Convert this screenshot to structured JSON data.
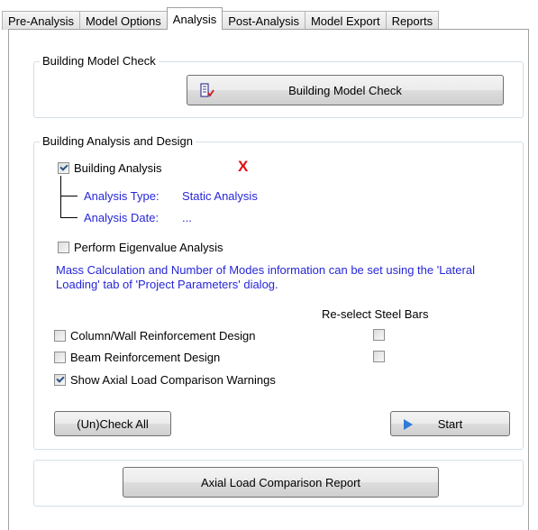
{
  "tabs": [
    {
      "label": "Pre-Analysis"
    },
    {
      "label": "Model Options"
    },
    {
      "label": "Analysis"
    },
    {
      "label": "Post-Analysis"
    },
    {
      "label": "Model Export"
    },
    {
      "label": "Reports"
    }
  ],
  "model_check": {
    "group_label": "Building Model Check",
    "button_label": "Building Model Check"
  },
  "analysis_design": {
    "group_label": "Building Analysis and Design",
    "building_analysis": {
      "label": "Building Analysis",
      "checked": true,
      "status_mark": "X"
    },
    "analysis_type": {
      "label": "Analysis Type:",
      "value": "Static Analysis"
    },
    "analysis_date": {
      "label": "Analysis Date:",
      "value": "..."
    },
    "eigenvalue": {
      "label": "Perform Eigenvalue Analysis",
      "checked": false
    },
    "info_text": "Mass Calculation and Number of Modes information can be set using the 'Lateral Loading' tab of 'Project Parameters' dialog.",
    "reselect_header": "Re-select Steel Bars",
    "column_wall": {
      "label": "Column/Wall Reinforcement Design",
      "checked": false,
      "reselect": false
    },
    "beam": {
      "label": "Beam Reinforcement Design",
      "checked": false,
      "reselect": false
    },
    "axial_warnings": {
      "label": "Show Axial Load Comparison Warnings",
      "checked": true
    },
    "uncheck_all_label": "(Un)Check All",
    "start_label": "Start"
  },
  "report_button_label": "Axial Load Comparison Report",
  "colors": {
    "info_blue": "#2626d9",
    "status_red": "#e01010",
    "play_blue": "#2f7bd8"
  },
  "icons": {
    "model_check": "model-check-icon",
    "start": "play-icon"
  }
}
